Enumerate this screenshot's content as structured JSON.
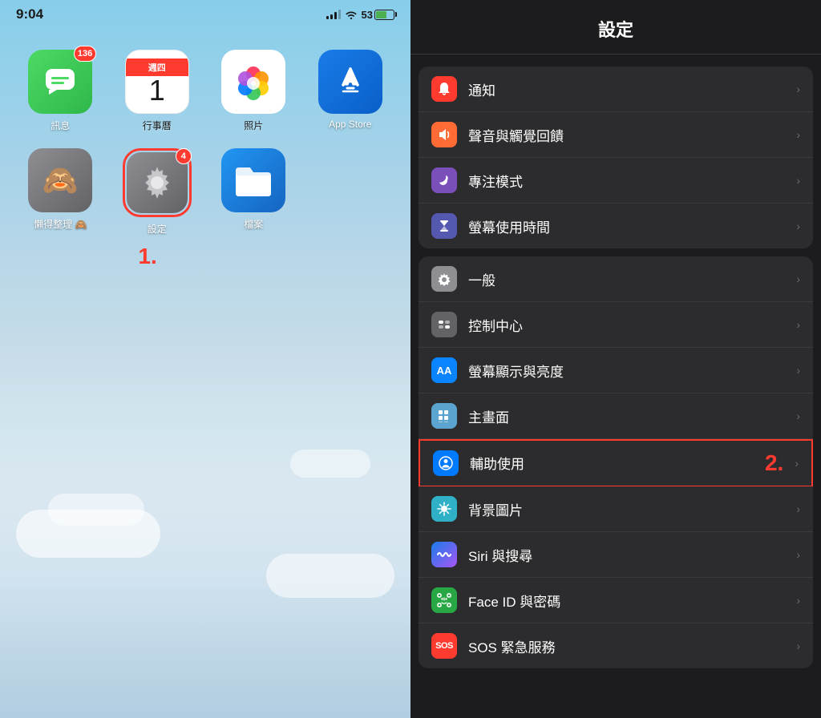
{
  "left": {
    "status_time": "9:04",
    "battery_percent": "53",
    "apps": [
      {
        "id": "messages",
        "label": "訊息",
        "badge": "136"
      },
      {
        "id": "calendar",
        "label": "行事曆",
        "day_name": "週四",
        "day": "1",
        "badge": null
      },
      {
        "id": "photos",
        "label": "照片",
        "badge": null
      },
      {
        "id": "appstore",
        "label": "App Store",
        "badge": null
      },
      {
        "id": "lazy",
        "label": "懶得整理 🙈",
        "badge": null
      },
      {
        "id": "settings",
        "label": "設定",
        "badge": "4"
      },
      {
        "id": "files",
        "label": "檔案",
        "badge": null
      }
    ],
    "step_label": "1."
  },
  "right": {
    "title": "設定",
    "sections": [
      {
        "items": [
          {
            "id": "notifications",
            "label": "通知",
            "icon_color": "red",
            "symbol": "bell"
          },
          {
            "id": "sounds",
            "label": "聲音與觸覺回饋",
            "icon_color": "orange-red",
            "symbol": "speaker"
          },
          {
            "id": "focus",
            "label": "專注模式",
            "icon_color": "purple",
            "symbol": "moon"
          },
          {
            "id": "screen_time",
            "label": "螢幕使用時間",
            "icon_color": "indigo",
            "symbol": "hourglass"
          }
        ]
      },
      {
        "items": [
          {
            "id": "general",
            "label": "一般",
            "icon_color": "gray",
            "symbol": "gear"
          },
          {
            "id": "control_center",
            "label": "控制中心",
            "icon_color": "gray2",
            "symbol": "toggle"
          },
          {
            "id": "display",
            "label": "螢幕顯示與亮度",
            "icon_color": "blue3",
            "symbol": "AA"
          },
          {
            "id": "home_screen",
            "label": "主畫面",
            "icon_color": "blue2",
            "symbol": "grid"
          },
          {
            "id": "accessibility",
            "label": "輔助使用",
            "icon_color": "blue",
            "symbol": "person_circle",
            "highlighted": true
          },
          {
            "id": "wallpaper",
            "label": "背景圖片",
            "icon_color": "teal",
            "symbol": "sparkles"
          },
          {
            "id": "siri",
            "label": "Siri 與搜尋",
            "icon_color": "siri",
            "symbol": "siri"
          },
          {
            "id": "faceid",
            "label": "Face ID 與密碼",
            "icon_color": "green2",
            "symbol": "face"
          },
          {
            "id": "sos",
            "label": "SOS 緊急服務",
            "icon_color": "red",
            "symbol": "sos"
          }
        ]
      }
    ],
    "step_label": "2."
  }
}
